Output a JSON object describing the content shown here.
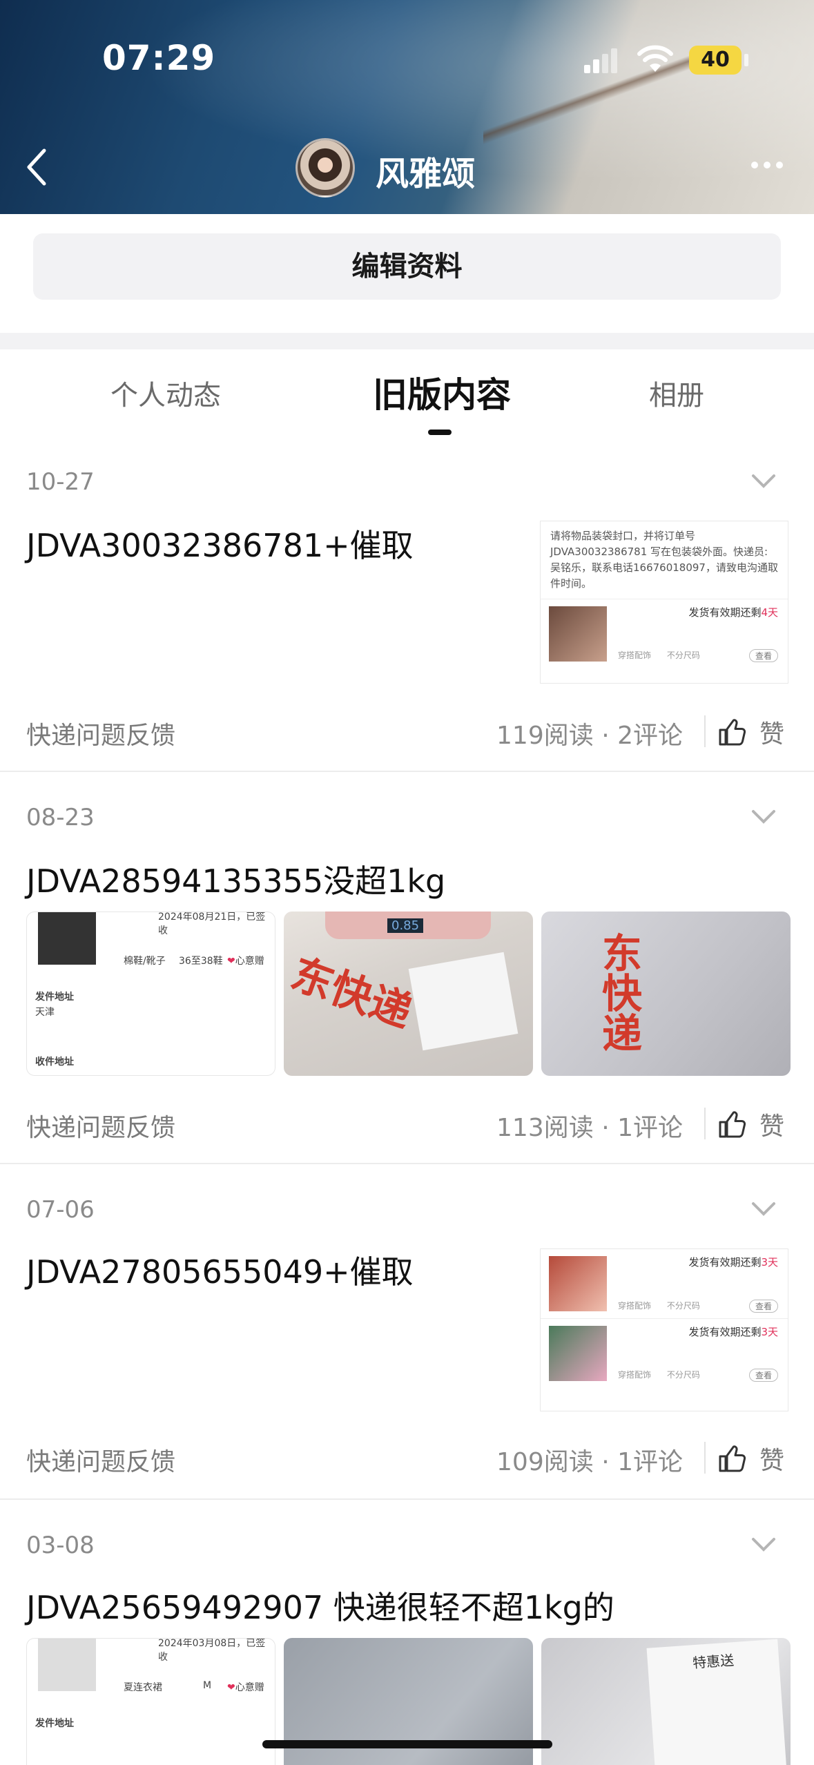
{
  "status_bar": {
    "time": "07:29",
    "battery": "40"
  },
  "header": {
    "name": "风雅颂",
    "edit_label": "编辑资料"
  },
  "tabs": [
    {
      "label": "个人动态"
    },
    {
      "label": "旧版内容"
    },
    {
      "label": "相册"
    }
  ],
  "posts": [
    {
      "date": "10-27",
      "title": "JDVA30032386781+催取",
      "tag": "快递问题反馈",
      "reads": "119阅读",
      "comments": "2评论",
      "like": "赞"
    },
    {
      "date": "08-23",
      "title": "JDVA28594135355没超1kg",
      "tag": "快递问题反馈",
      "reads": "113阅读",
      "comments": "1评论",
      "like": "赞"
    },
    {
      "date": "07-06",
      "title": "JDVA27805655049+催取",
      "tag": "快递问题反馈",
      "reads": "109阅读",
      "comments": "1评论",
      "like": "赞"
    },
    {
      "date": "03-08",
      "title": "JDVA25659492907 快递很轻不超1kg的"
    }
  ],
  "thumb1": {
    "text": "请将物品装袋封口，并将订单号 JDVA30032386781 写在包装袋外面。快递员:吴铭乐，联系电话16676018097，请致电沟通取件时间。",
    "deadline_prefix": "发货有效期还剩",
    "deadline_days": "4天",
    "item_meta": "穿搭配饰",
    "size_meta": "不分尺码",
    "view_btn": "查看"
  },
  "thumb3": {
    "deadline_prefix": "发货有效期还剩",
    "deadline_days": "3天",
    "item_meta": "穿搭配饰",
    "size_meta": "不分尺码",
    "view_btn": "查看"
  },
  "grid2_doc": {
    "date": "2024年08月21日，已签收",
    "item": "棉鞋/靴子",
    "size": "36至38鞋",
    "wish": "心意赠",
    "send_label": "发件地址",
    "send_city": "天津",
    "recv_label": "收件地址",
    "scale_reading": "0.85",
    "bag_logo": "东快递"
  },
  "grid4_doc": {
    "date": "2024年03月08日，已签收",
    "item": "夏连衣裙",
    "size": "M",
    "wish": "心意赠",
    "send_label": "发件地址",
    "label_text": "特惠送"
  },
  "colors": {
    "accent_red": "#e0305a",
    "battery_yellow": "#f5d742",
    "brand_red": "#d23a2b"
  }
}
